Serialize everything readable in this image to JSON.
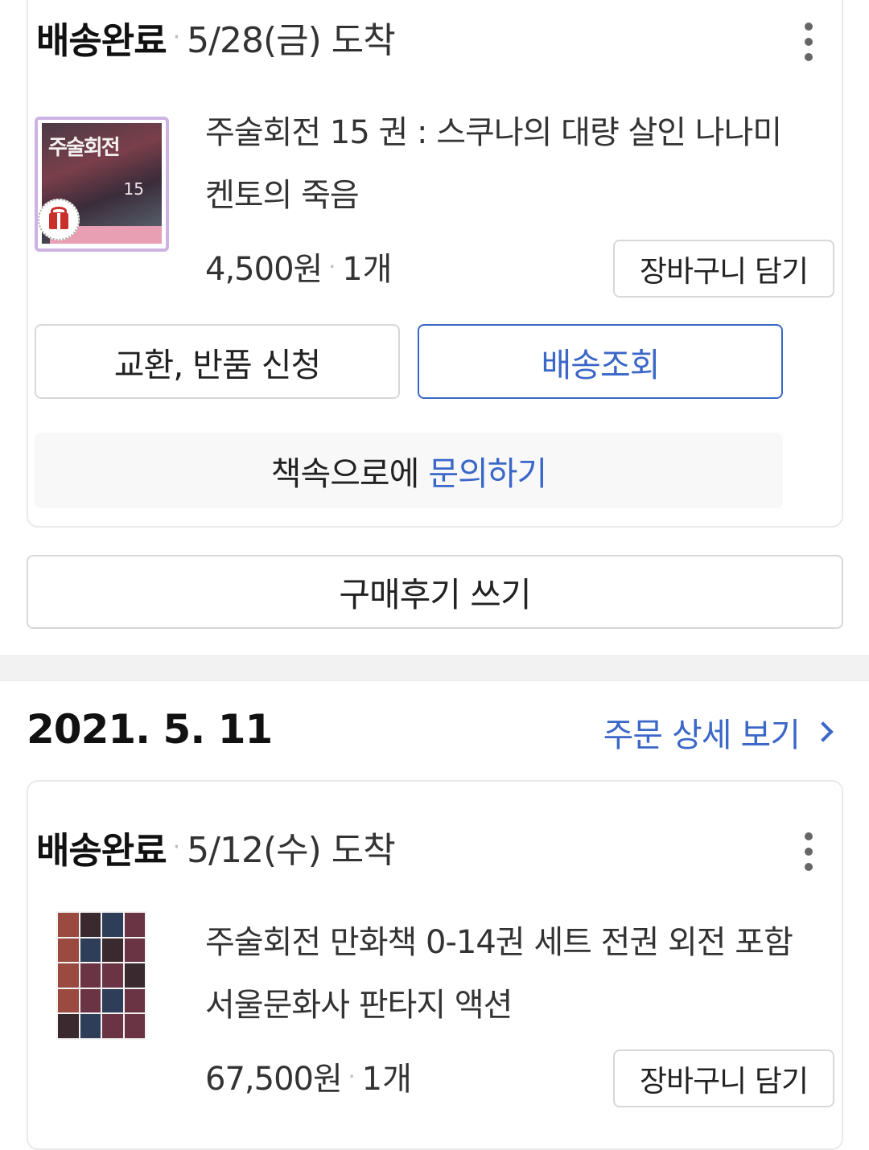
{
  "orders": [
    {
      "status": "배송완료",
      "separator": "·",
      "arrival": "5/28(금) 도착",
      "item": {
        "title": "주술회전 15 권 : 스쿠나의 대량 살인 나나미 켄토의 죽음",
        "cover_text": "주술회전",
        "cover_volume": "15",
        "price": "4,500원",
        "quantity": "1개",
        "gift_icon": "gift-icon"
      },
      "cart_label": "장바구니 담기",
      "return_label": "교환, 반품 신청",
      "tracking_label": "배송조회",
      "inquiry_seller": "책속으로에",
      "inquiry_link": "문의하기",
      "review_label": "구매후기 쓰기"
    },
    {
      "order_date": "2021. 5. 11",
      "order_detail_link": "주문 상세 보기",
      "status": "배송완료",
      "separator": "·",
      "arrival": "5/12(수) 도착",
      "item": {
        "title": "주술회전 만화책 0-14권 세트 전권 외전 포함 서울문화사 판타지 액션",
        "price": "67,500원",
        "quantity": "1개"
      },
      "cart_label": "장바구니 담기"
    }
  ],
  "colors": {
    "accent_blue": "#3a67c8",
    "border_gray": "#d8d8d8",
    "gift_border": "#cdb2e4"
  }
}
